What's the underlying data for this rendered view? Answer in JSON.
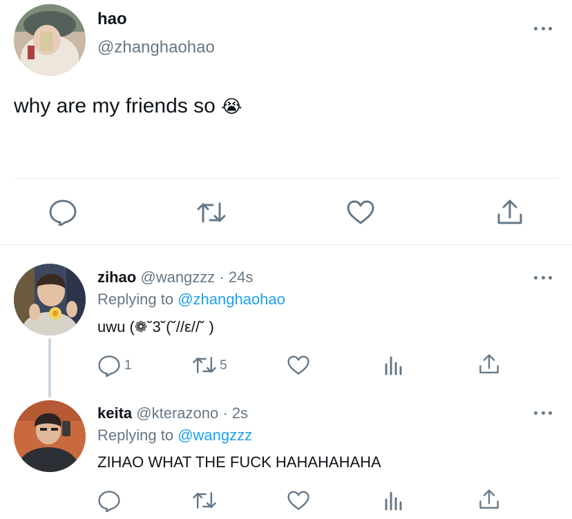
{
  "main_tweet": {
    "display_name": "hao",
    "handle": "@zhanghaohao",
    "text": "why are my friends so",
    "emoji": "😭"
  },
  "replies": [
    {
      "display_name": "zihao",
      "handle": "@wangzzz",
      "separator": "·",
      "time": "24s",
      "replying_prefix": "Replying to",
      "replying_to": "@zhanghaohao",
      "text": "uwu (❁˘3˘(˘//ε//˘ )",
      "reply_count": "1",
      "retweet_count": "5"
    },
    {
      "display_name": "keita",
      "handle": "@kterazono",
      "separator": "·",
      "time": "2s",
      "replying_prefix": "Replying to",
      "replying_to": "@wangzzz",
      "text": "ZIHAO WHAT THE FUCK HAHAHAHAHA"
    }
  ],
  "colors": {
    "icon_gray": "#657786",
    "link_blue": "#1da1f2",
    "divider": "#e1e8ed"
  }
}
